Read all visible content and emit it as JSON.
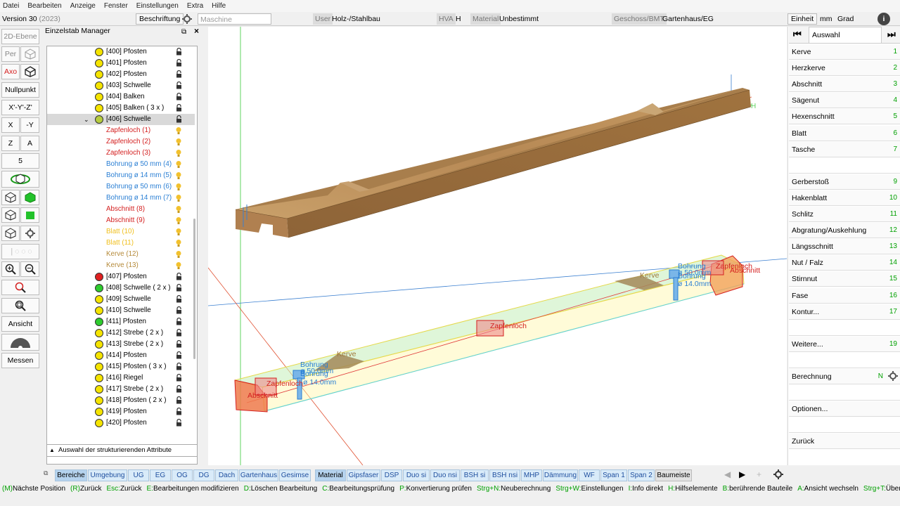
{
  "menu": [
    "Datei",
    "Bearbeiten",
    "Anzeige",
    "Fenster",
    "Einstellungen",
    "Extra",
    "Hilfe"
  ],
  "header": {
    "version": "Version 30",
    "year": "(2023)",
    "beschriftung": "Beschriftung",
    "maschine_placeholder": "Maschine",
    "user_label": "User",
    "user_value": "Holz-/Stahlbau",
    "hva_label": "HVA",
    "hva_value": "H",
    "material_label": "Material",
    "material_value": "Unbestimmt",
    "geschoss_label": "Geschoss/BMT",
    "geschoss_value": "Gartenhaus/EG",
    "einheit_label": "Einheit",
    "unit_mm": "mm",
    "unit_grad": "Grad"
  },
  "toolbar": {
    "ebene": "2D-Ebene",
    "per": "Per",
    "axo": "Axo",
    "nullpunkt": "Nullpunkt",
    "xyz": "X'-Y'-Z'",
    "x": "X",
    "my": "-Y",
    "z": "Z",
    "a": "A",
    "five": "5",
    "ansicht": "Ansicht",
    "messen": "Messen"
  },
  "panel": {
    "title": "Einzelstab Manager",
    "bottom": "Auswahl der strukturierenden Attribute",
    "items": [
      {
        "label": "[400] Pfosten",
        "dot": "#f5e400"
      },
      {
        "label": "[401] Pfosten",
        "dot": "#f5e400"
      },
      {
        "label": "[402] Pfosten",
        "dot": "#f5e400"
      },
      {
        "label": "[403] Schwelle",
        "dot": "#f5e400"
      },
      {
        "label": "[404] Balken",
        "dot": "#f5e400"
      },
      {
        "label": "[405] Balken ( 3 x )",
        "dot": "#f5e400"
      },
      {
        "label": "[406] Schwelle",
        "dot": "#b6cc3e",
        "selected": true
      },
      {
        "label": "Zapfenloch (1)",
        "color": "#d42020",
        "sub": true
      },
      {
        "label": "Zapfenloch (2)",
        "color": "#d42020",
        "sub": true
      },
      {
        "label": "Zapfenloch (3)",
        "color": "#d42020",
        "sub": true
      },
      {
        "label": "Bohrung ø 50 mm (4)",
        "color": "#2a7fd4",
        "sub": true
      },
      {
        "label": "Bohrung ø 14 mm (5)",
        "color": "#2a7fd4",
        "sub": true
      },
      {
        "label": "Bohrung ø 50 mm (6)",
        "color": "#2a7fd4",
        "sub": true
      },
      {
        "label": "Bohrung ø 14 mm (7)",
        "color": "#2a7fd4",
        "sub": true
      },
      {
        "label": "Abschnitt (8)",
        "color": "#d42020",
        "sub": true
      },
      {
        "label": "Abschnitt (9)",
        "color": "#d42020",
        "sub": true
      },
      {
        "label": "Blatt (10)",
        "color": "#f0c020",
        "sub": true
      },
      {
        "label": "Blatt (11)",
        "color": "#f0c020",
        "sub": true
      },
      {
        "label": "Kerve (12)",
        "color": "#b58a3a",
        "sub": true
      },
      {
        "label": "Kerve (13)",
        "color": "#b58a3a",
        "sub": true
      },
      {
        "label": "[407] Pfosten",
        "dot": "#e02020"
      },
      {
        "label": "[408] Schwelle ( 2 x )",
        "dot": "#2ecc2e"
      },
      {
        "label": "[409] Schwelle",
        "dot": "#f5e400"
      },
      {
        "label": "[410] Schwelle",
        "dot": "#f5e400"
      },
      {
        "label": "[411] Pfosten",
        "dot": "#2ecc2e"
      },
      {
        "label": "[412] Strebe ( 2 x )",
        "dot": "#f5e400"
      },
      {
        "label": "[413] Strebe ( 2 x )",
        "dot": "#f5e400"
      },
      {
        "label": "[414] Pfosten",
        "dot": "#f5e400"
      },
      {
        "label": "[415] Pfosten ( 3 x )",
        "dot": "#f5e400"
      },
      {
        "label": "[416] Riegel",
        "dot": "#f5e400"
      },
      {
        "label": "[417] Strebe ( 2 x )",
        "dot": "#f5e400"
      },
      {
        "label": "[418] Pfosten ( 2 x )",
        "dot": "#f5e400"
      },
      {
        "label": "[419] Pfosten",
        "dot": "#f5e400"
      },
      {
        "label": "[420] Pfosten",
        "dot": "#f5e400"
      }
    ]
  },
  "viewport": {
    "axis_label": "H",
    "annotations": {
      "kerve": "Kerve",
      "bohrung": "Bohrung",
      "bohrung_50": "ø 50.0mm",
      "bohrung_14": "ø 14.0mm",
      "zapfenloch": "Zapfenloch",
      "abschnitt": "Abschnitt"
    }
  },
  "right": {
    "auswahl": "Auswahl",
    "items": [
      {
        "label": "Kerve",
        "num": "1"
      },
      {
        "label": "Herzkerve",
        "num": "2"
      },
      {
        "label": "Abschnitt",
        "num": "3"
      },
      {
        "label": "Sägenut",
        "num": "4"
      },
      {
        "label": "Hexenschnitt",
        "num": "5"
      },
      {
        "label": "Blatt",
        "num": "6"
      },
      {
        "label": "Tasche",
        "num": "7"
      },
      {
        "label": "",
        "num": ""
      },
      {
        "label": "Gerberstoß",
        "num": "9"
      },
      {
        "label": "Hakenblatt",
        "num": "10"
      },
      {
        "label": "Schlitz",
        "num": "11"
      },
      {
        "label": "Abgratung/Auskehlung",
        "num": "12"
      },
      {
        "label": "Längsschnitt",
        "num": "13"
      },
      {
        "label": "Nut / Falz",
        "num": "14"
      },
      {
        "label": "Stirnnut",
        "num": "15"
      },
      {
        "label": "Fase",
        "num": "16"
      },
      {
        "label": "Kontur...",
        "num": "17"
      },
      {
        "label": "",
        "num": ""
      },
      {
        "label": "Weitere...",
        "num": "19"
      },
      {
        "label": "",
        "num": ""
      },
      {
        "label": "Berechnung",
        "num": "N"
      },
      {
        "label": "",
        "num": ""
      },
      {
        "label": "Optionen...",
        "num": ""
      },
      {
        "label": "",
        "num": ""
      },
      {
        "label": "Zurück",
        "num": ""
      }
    ]
  },
  "tabs": [
    {
      "label": "Bereiche",
      "w": 46,
      "active": true
    },
    {
      "label": "Umgebung",
      "w": 56
    },
    {
      "label": "UG",
      "w": 30
    },
    {
      "label": "EG",
      "w": 30
    },
    {
      "label": "OG",
      "w": 30
    },
    {
      "label": "DG",
      "w": 30
    },
    {
      "label": "Dach",
      "w": 33
    },
    {
      "label": "Gartenhaus",
      "w": 56
    },
    {
      "label": "Gesimse",
      "w": 45
    },
    {
      "label": "Material",
      "w": 44,
      "active": true
    },
    {
      "label": "Gipsfaser",
      "w": 48
    },
    {
      "label": "DSP",
      "w": 30
    },
    {
      "label": "Duo si",
      "w": 38
    },
    {
      "label": "Duo nsi",
      "w": 42
    },
    {
      "label": "BSH si",
      "w": 40
    },
    {
      "label": "BSH nsi",
      "w": 44
    },
    {
      "label": "MHP",
      "w": 30
    },
    {
      "label": "Dämmung",
      "w": 50
    },
    {
      "label": "WF",
      "w": 30
    },
    {
      "label": "Span 1",
      "w": 38
    },
    {
      "label": "Span 2",
      "w": 38
    },
    {
      "label": "Baumeiste",
      "w": 52,
      "gray": true
    }
  ],
  "status": [
    {
      "k": "(M)",
      "t": "Nächste Position"
    },
    {
      "k": "(R)",
      "t": "Zurück"
    },
    {
      "k": "Esc:",
      "t": "Zurück"
    },
    {
      "k": "E:",
      "t": "Bearbeitungen modifizieren"
    },
    {
      "k": "D:",
      "t": "Löschen Bearbeitung"
    },
    {
      "k": "C:",
      "t": "Bearbeitungsprüfung"
    },
    {
      "k": "P:",
      "t": "Konvertierung prüfen"
    },
    {
      "k": "Strg+N:",
      "t": "Neuberechnung"
    },
    {
      "k": "Strg+W:",
      "t": "Einstellungen"
    },
    {
      "k": "I:",
      "t": "Info direkt"
    },
    {
      "k": "H:",
      "t": "Hilfselemente"
    },
    {
      "k": "B:",
      "t": "berührende Bauteile"
    },
    {
      "k": "A:",
      "t": "Ansicht wechseln"
    },
    {
      "k": "Strg+T:",
      "t": "Überlagern"
    }
  ]
}
